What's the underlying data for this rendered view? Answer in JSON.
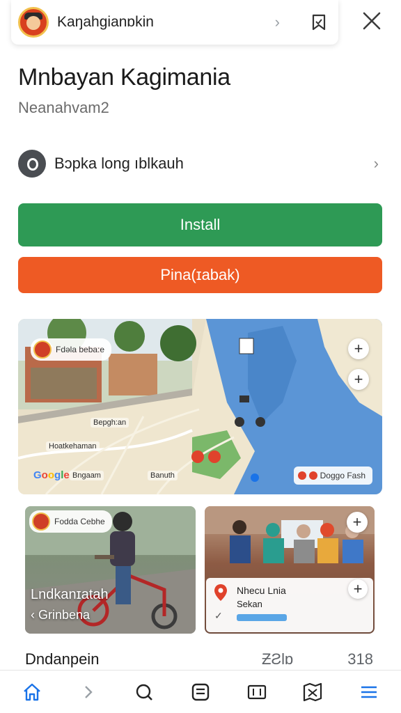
{
  "topbar": {
    "title": "Kaŋahgianɒkin",
    "chevron_icon": "chevron-right-icon",
    "share_icon": "bookmark-icon",
    "close_icon": "close-icon"
  },
  "app": {
    "name": "Mnbayan Kagimania",
    "subtitle": "Neanahvam2"
  },
  "developer": {
    "label": "Bɔpka long ıblkauh",
    "icon": "developer-icon"
  },
  "buttons": {
    "install": "Install",
    "secondary": "Pina(ɪabak)"
  },
  "map_card": {
    "pill_label": "Fdəla beba:e",
    "labels": [
      "Bepgh:an",
      "Hoatkehaman",
      "Bngaam",
      "Banuth"
    ],
    "chip_label": "Doggo Fash",
    "google_logo": "Google"
  },
  "screenshots": [
    {
      "pill": "Fodda Cebhe",
      "title": "Lndkanɪatah",
      "sub": "Grinbena"
    },
    {
      "t1": "Nhecu Lnia",
      "t2": "Sekan"
    }
  ],
  "stats": {
    "label": "Dndanpein",
    "value1": "ƵƧlɒ",
    "value2": "318"
  },
  "nav": [
    "home-icon",
    "forward-icon",
    "search-icon",
    "library-icon",
    "map-icon",
    "compass-map-icon",
    "menu-icon"
  ],
  "colors": {
    "install": "#2e9a55",
    "secondary": "#ee5a24",
    "accent_blue": "#1a73e8"
  }
}
